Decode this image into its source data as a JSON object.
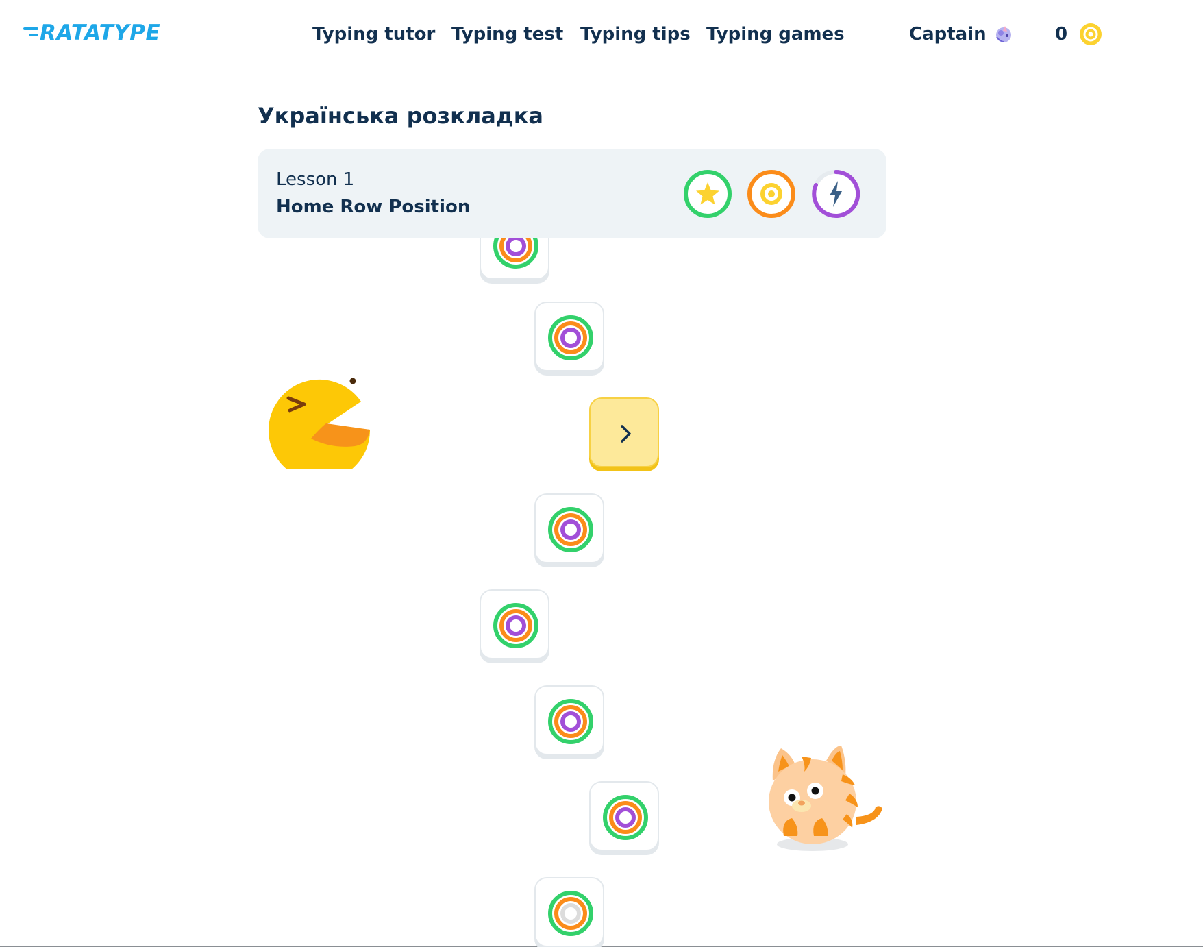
{
  "header": {
    "logo_text": "RATATYPE",
    "nav": [
      {
        "label": "Typing tutor"
      },
      {
        "label": "Typing test"
      },
      {
        "label": "Typing tips"
      },
      {
        "label": "Typing games"
      }
    ],
    "user_name": "Captain",
    "avatar_icon": "unicorn-icon",
    "coins": "0",
    "coin_icon": "coin-icon"
  },
  "section_title": "Українська розкладка",
  "lesson": {
    "number": "Lesson 1",
    "name": "Home Row Position",
    "badges": [
      "star-badge-icon",
      "accuracy-badge-icon",
      "speed-badge-icon"
    ]
  },
  "map": {
    "current_step_icon": "chevron-right-icon",
    "steps": [
      {
        "state": "completed",
        "icon": "target-icon"
      },
      {
        "state": "completed",
        "icon": "target-icon"
      },
      {
        "state": "current",
        "icon": "chevron-right-icon"
      },
      {
        "state": "completed",
        "icon": "target-icon"
      },
      {
        "state": "completed",
        "icon": "target-icon"
      },
      {
        "state": "completed",
        "icon": "target-icon"
      },
      {
        "state": "completed",
        "icon": "target-icon"
      },
      {
        "state": "partial",
        "icon": "target-icon"
      }
    ]
  },
  "colors": {
    "brand": "#1ea7e8",
    "text": "#12304f",
    "green": "#33d16b",
    "orange": "#fb8c1a",
    "purple": "#a24fd8",
    "yellow": "#fcd230",
    "card_bg": "#eef3f6"
  }
}
